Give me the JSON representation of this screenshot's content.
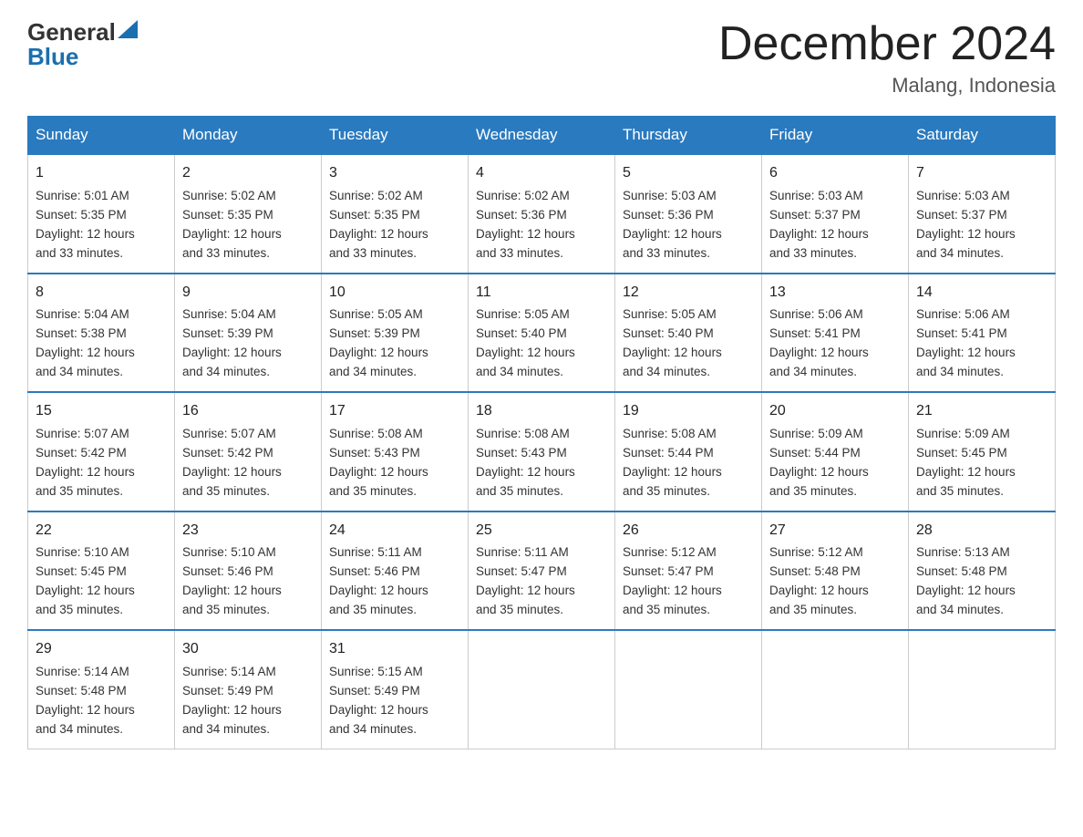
{
  "header": {
    "logo_general": "General",
    "logo_blue": "Blue",
    "month_title": "December 2024",
    "location": "Malang, Indonesia"
  },
  "days_of_week": [
    "Sunday",
    "Monday",
    "Tuesday",
    "Wednesday",
    "Thursday",
    "Friday",
    "Saturday"
  ],
  "weeks": [
    [
      {
        "day": "1",
        "sunrise": "5:01 AM",
        "sunset": "5:35 PM",
        "daylight": "12 hours and 33 minutes."
      },
      {
        "day": "2",
        "sunrise": "5:02 AM",
        "sunset": "5:35 PM",
        "daylight": "12 hours and 33 minutes."
      },
      {
        "day": "3",
        "sunrise": "5:02 AM",
        "sunset": "5:35 PM",
        "daylight": "12 hours and 33 minutes."
      },
      {
        "day": "4",
        "sunrise": "5:02 AM",
        "sunset": "5:36 PM",
        "daylight": "12 hours and 33 minutes."
      },
      {
        "day": "5",
        "sunrise": "5:03 AM",
        "sunset": "5:36 PM",
        "daylight": "12 hours and 33 minutes."
      },
      {
        "day": "6",
        "sunrise": "5:03 AM",
        "sunset": "5:37 PM",
        "daylight": "12 hours and 33 minutes."
      },
      {
        "day": "7",
        "sunrise": "5:03 AM",
        "sunset": "5:37 PM",
        "daylight": "12 hours and 34 minutes."
      }
    ],
    [
      {
        "day": "8",
        "sunrise": "5:04 AM",
        "sunset": "5:38 PM",
        "daylight": "12 hours and 34 minutes."
      },
      {
        "day": "9",
        "sunrise": "5:04 AM",
        "sunset": "5:39 PM",
        "daylight": "12 hours and 34 minutes."
      },
      {
        "day": "10",
        "sunrise": "5:05 AM",
        "sunset": "5:39 PM",
        "daylight": "12 hours and 34 minutes."
      },
      {
        "day": "11",
        "sunrise": "5:05 AM",
        "sunset": "5:40 PM",
        "daylight": "12 hours and 34 minutes."
      },
      {
        "day": "12",
        "sunrise": "5:05 AM",
        "sunset": "5:40 PM",
        "daylight": "12 hours and 34 minutes."
      },
      {
        "day": "13",
        "sunrise": "5:06 AM",
        "sunset": "5:41 PM",
        "daylight": "12 hours and 34 minutes."
      },
      {
        "day": "14",
        "sunrise": "5:06 AM",
        "sunset": "5:41 PM",
        "daylight": "12 hours and 34 minutes."
      }
    ],
    [
      {
        "day": "15",
        "sunrise": "5:07 AM",
        "sunset": "5:42 PM",
        "daylight": "12 hours and 35 minutes."
      },
      {
        "day": "16",
        "sunrise": "5:07 AM",
        "sunset": "5:42 PM",
        "daylight": "12 hours and 35 minutes."
      },
      {
        "day": "17",
        "sunrise": "5:08 AM",
        "sunset": "5:43 PM",
        "daylight": "12 hours and 35 minutes."
      },
      {
        "day": "18",
        "sunrise": "5:08 AM",
        "sunset": "5:43 PM",
        "daylight": "12 hours and 35 minutes."
      },
      {
        "day": "19",
        "sunrise": "5:08 AM",
        "sunset": "5:44 PM",
        "daylight": "12 hours and 35 minutes."
      },
      {
        "day": "20",
        "sunrise": "5:09 AM",
        "sunset": "5:44 PM",
        "daylight": "12 hours and 35 minutes."
      },
      {
        "day": "21",
        "sunrise": "5:09 AM",
        "sunset": "5:45 PM",
        "daylight": "12 hours and 35 minutes."
      }
    ],
    [
      {
        "day": "22",
        "sunrise": "5:10 AM",
        "sunset": "5:45 PM",
        "daylight": "12 hours and 35 minutes."
      },
      {
        "day": "23",
        "sunrise": "5:10 AM",
        "sunset": "5:46 PM",
        "daylight": "12 hours and 35 minutes."
      },
      {
        "day": "24",
        "sunrise": "5:11 AM",
        "sunset": "5:46 PM",
        "daylight": "12 hours and 35 minutes."
      },
      {
        "day": "25",
        "sunrise": "5:11 AM",
        "sunset": "5:47 PM",
        "daylight": "12 hours and 35 minutes."
      },
      {
        "day": "26",
        "sunrise": "5:12 AM",
        "sunset": "5:47 PM",
        "daylight": "12 hours and 35 minutes."
      },
      {
        "day": "27",
        "sunrise": "5:12 AM",
        "sunset": "5:48 PM",
        "daylight": "12 hours and 35 minutes."
      },
      {
        "day": "28",
        "sunrise": "5:13 AM",
        "sunset": "5:48 PM",
        "daylight": "12 hours and 34 minutes."
      }
    ],
    [
      {
        "day": "29",
        "sunrise": "5:14 AM",
        "sunset": "5:48 PM",
        "daylight": "12 hours and 34 minutes."
      },
      {
        "day": "30",
        "sunrise": "5:14 AM",
        "sunset": "5:49 PM",
        "daylight": "12 hours and 34 minutes."
      },
      {
        "day": "31",
        "sunrise": "5:15 AM",
        "sunset": "5:49 PM",
        "daylight": "12 hours and 34 minutes."
      },
      null,
      null,
      null,
      null
    ]
  ],
  "labels": {
    "sunrise": "Sunrise:",
    "sunset": "Sunset:",
    "daylight": "Daylight:"
  }
}
